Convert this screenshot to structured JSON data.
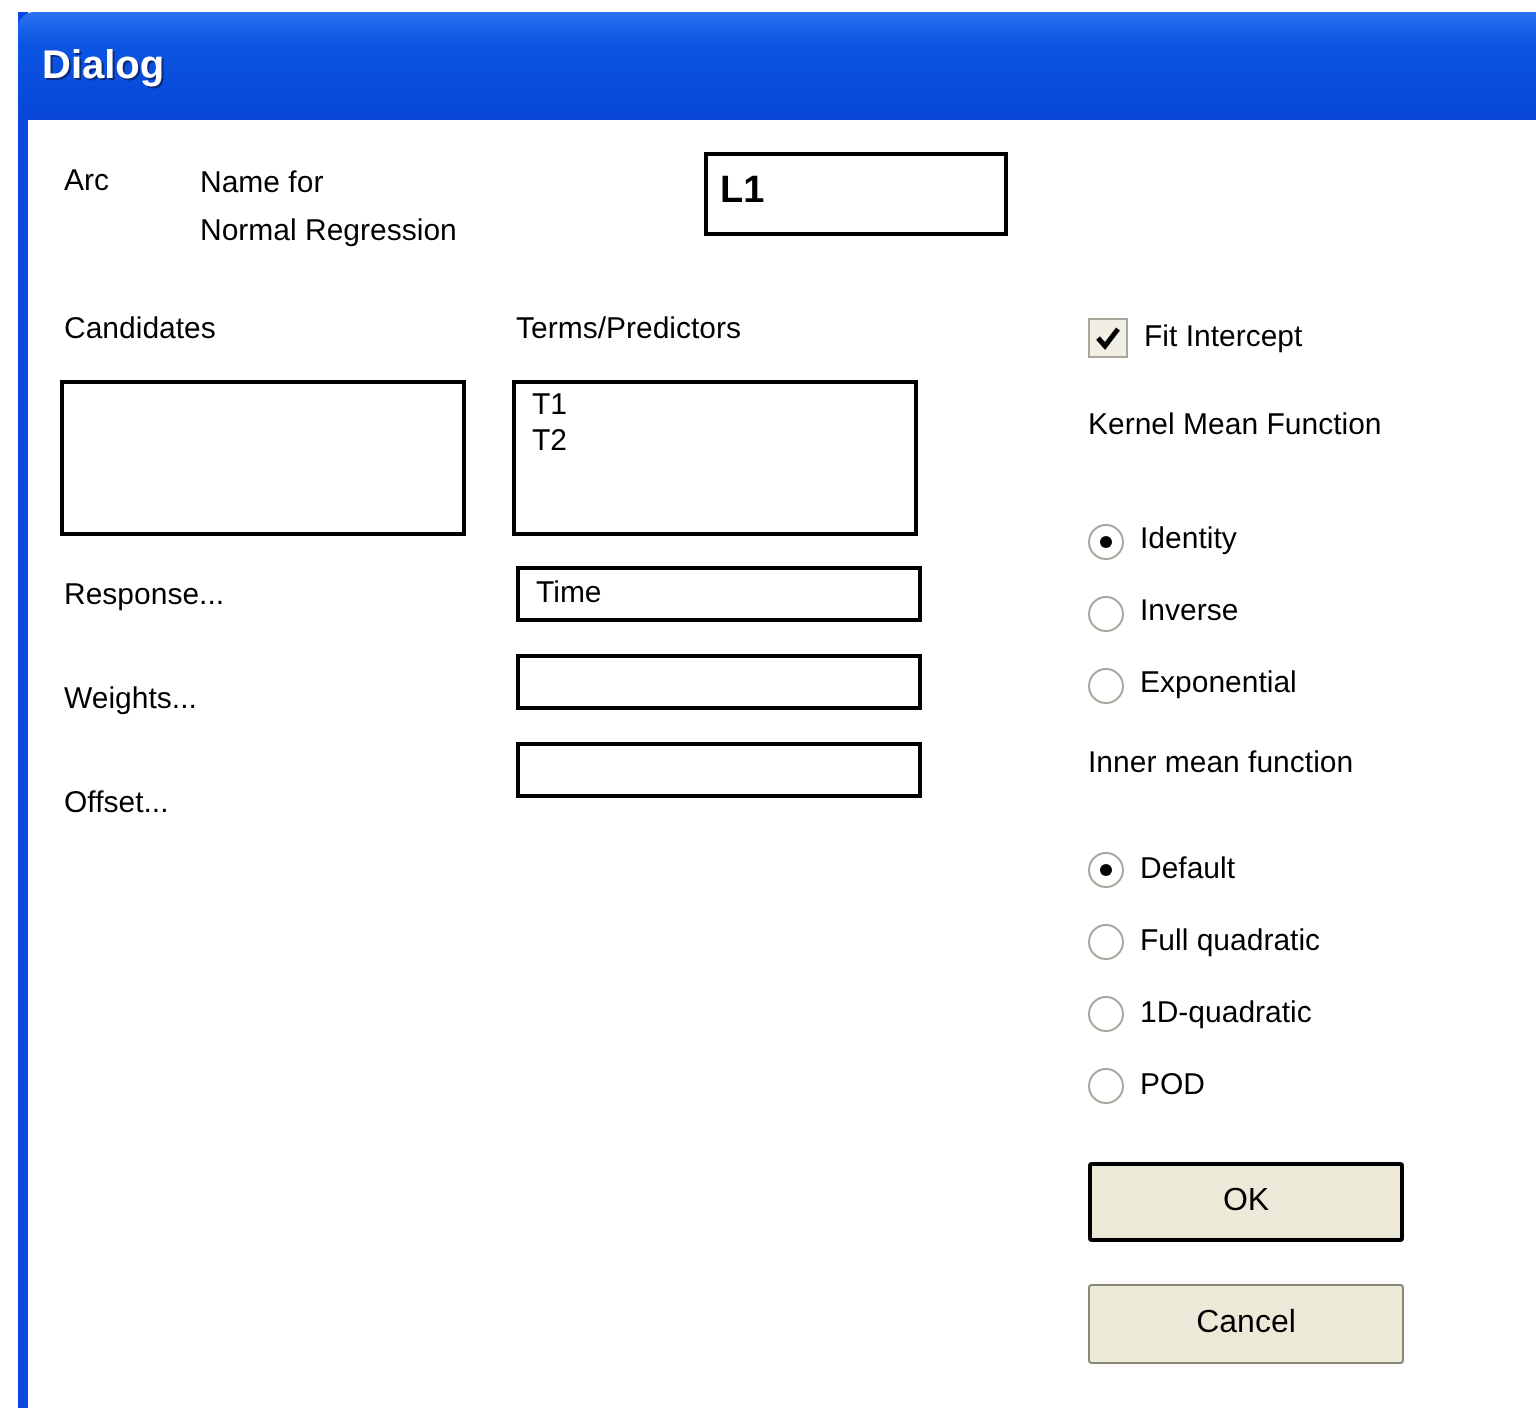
{
  "window": {
    "title": "Dialog"
  },
  "header": {
    "app": "Arc",
    "name_label": [
      "Name for",
      "Normal Regression"
    ],
    "name_value": "L1"
  },
  "candidates": {
    "label": "Candidates"
  },
  "terms": {
    "label": "Terms/Predictors",
    "items": [
      "T1",
      "T2"
    ]
  },
  "fields": [
    {
      "label": "Response...",
      "value": "Time"
    },
    {
      "label": "Weights..."
    },
    {
      "label": "Offset..."
    }
  ],
  "fit_intercept": {
    "label": "Fit Intercept",
    "checked": true
  },
  "kernel": {
    "label": "Kernel Mean Function",
    "options": [
      {
        "label": "Identity",
        "selected": true
      },
      {
        "label": "Inverse",
        "selected": false
      },
      {
        "label": "Exponential",
        "selected": false
      }
    ]
  },
  "inner": {
    "label": "Inner mean function",
    "options": [
      {
        "label": "Default",
        "selected": true
      },
      {
        "label": "Full quadratic",
        "selected": false
      },
      {
        "label": "1D-quadratic",
        "selected": false
      },
      {
        "label": "POD",
        "selected": false
      }
    ]
  },
  "buttons": [
    {
      "label": "OK",
      "default": true
    },
    {
      "label": "Cancel",
      "default": false
    }
  ]
}
